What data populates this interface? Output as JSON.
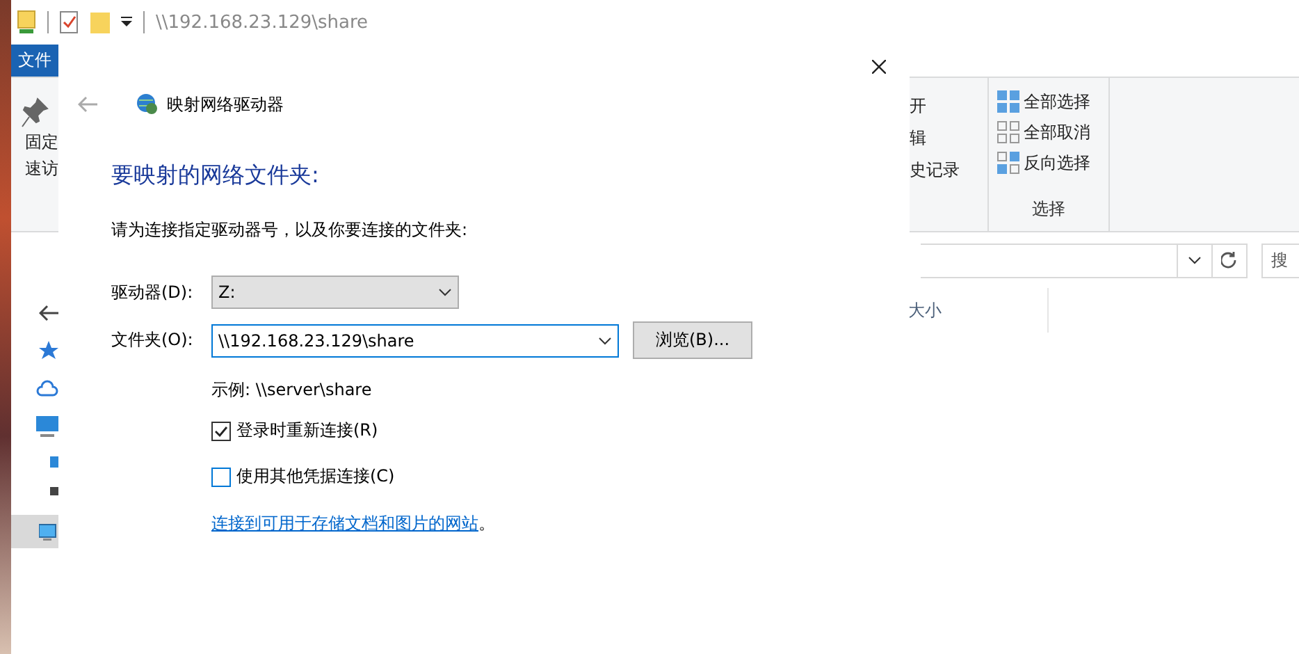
{
  "explorer": {
    "path": "\\\\192.168.23.129\\share",
    "file_tab": "文件",
    "pin_label": [
      "固定",
      "速访"
    ],
    "open_items": [
      "开",
      "辑",
      "史记录"
    ],
    "select_items": [
      {
        "kind": "all",
        "label": "全部选择"
      },
      {
        "kind": "none",
        "label": "全部取消"
      },
      {
        "kind": "invert",
        "label": "反向选择"
      }
    ],
    "select_group_label": "选择",
    "search_placeholder": "搜",
    "column": "大小"
  },
  "dialog": {
    "title": "映射网络驱动器",
    "heading": "要映射的网络文件夹:",
    "instruction": "请为连接指定驱动器号，以及你要连接的文件夹:",
    "drive_label": "驱动器(D):",
    "drive_value": "Z:",
    "folder_label": "文件夹(O):",
    "folder_value": "\\\\192.168.23.129\\share",
    "browse": "浏览(B)...",
    "example": "示例: \\\\server\\share",
    "options": [
      {
        "label": "登录时重新连接(R)",
        "checked": true
      },
      {
        "label": "使用其他凭据连接(C)",
        "checked": false
      }
    ],
    "link": "连接到可用于存储文档和图片的网站",
    "link_suffix": "。"
  }
}
